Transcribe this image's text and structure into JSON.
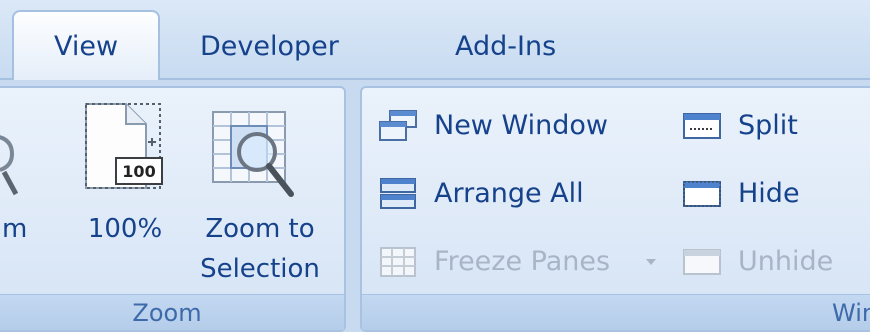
{
  "tabs": [
    {
      "label": "View",
      "active": true
    },
    {
      "label": "Developer",
      "active": false
    },
    {
      "label": "Add-Ins",
      "active": false
    }
  ],
  "zoom_group": {
    "label": "Zoom",
    "zoom_partial_label": "m",
    "btn_100": {
      "label": "100%",
      "icon_text": "100"
    },
    "zoom_selection": {
      "label_line1": "Zoom to",
      "label_line2": "Selection"
    }
  },
  "window_group": {
    "label": "Wind",
    "new_window": {
      "label": "New Window"
    },
    "arrange_all": {
      "label": "Arrange All"
    },
    "freeze_panes": {
      "label": "Freeze Panes",
      "enabled": false
    },
    "split": {
      "label": "Split"
    },
    "hide": {
      "label": "Hide"
    },
    "unhide": {
      "label": "Unhide",
      "enabled": false
    }
  },
  "colors": {
    "ribbon_text": "#15428b",
    "disabled_text": "#a8b5c6",
    "group_label": "#3e6aaa"
  }
}
